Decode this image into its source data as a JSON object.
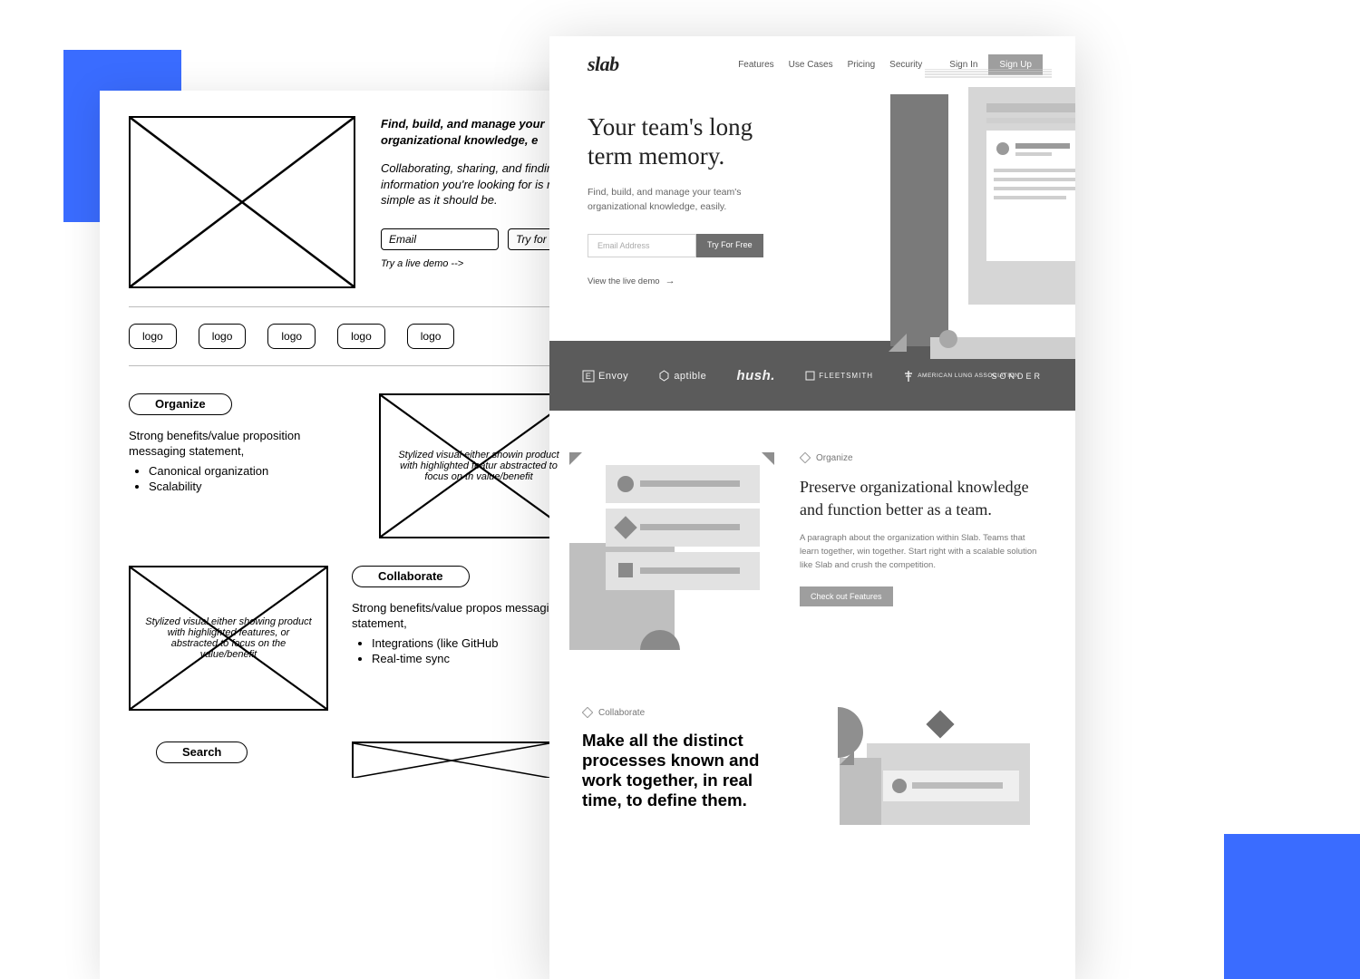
{
  "wireframe": {
    "hero": {
      "title": "Find, build, and manage your organizational knowledge, e",
      "sub": "Collaborating, sharing, and finding information you're looking for is no simple as it should be.",
      "email_label": "Email",
      "try_button": "Try for f",
      "demo_link": "Try a live demo -->"
    },
    "logos": [
      "logo",
      "logo",
      "logo",
      "logo",
      "logo"
    ],
    "organize": {
      "pill": "Organize",
      "headline": "Strong benefits/value proposition messaging statement,",
      "bullets": [
        "Canonical organization",
        "Scalability"
      ],
      "img_caption": "Stylized visual either showin product with highlighted featur abstracted to focus on th value/benefit"
    },
    "collaborate": {
      "pill": "Collaborate",
      "headline": "Strong benefits/value propos messaging statement,",
      "bullets": [
        "Integrations (like GitHub",
        "Real-time sync"
      ],
      "img_caption": "Stylized visual either showing product with highlighted features, or abstracted to focus on the value/benefit"
    },
    "search": {
      "pill": "Search"
    }
  },
  "mockup": {
    "logo": "slab",
    "nav": [
      "Features",
      "Use Cases",
      "Pricing",
      "Security"
    ],
    "auth": {
      "signin": "Sign In",
      "signup": "Sign Up"
    },
    "hero": {
      "title": "Your team's long term memory.",
      "sub": "Find, build, and manage your team's organizational knowledge, easily.",
      "email_placeholder": "Email Address",
      "cta": "Try For Free",
      "demo": "View the live demo"
    },
    "logobar": [
      "Envoy",
      "aptible",
      "hush.",
      "FLEETSMITH",
      "AMERICAN LUNG ASSOCIATION",
      "SONDER"
    ],
    "organize": {
      "tag": "Organize",
      "title": "Preserve organizational knowledge and function better as a team.",
      "body": "A paragraph about the organization within Slab. Teams that learn together, win together. Start right with a scalable solution like Slab and crush the competition.",
      "button": "Check out Features"
    },
    "collaborate": {
      "tag": "Collaborate",
      "title": "Make all the distinct processes known and work together, in real time, to define them."
    }
  }
}
